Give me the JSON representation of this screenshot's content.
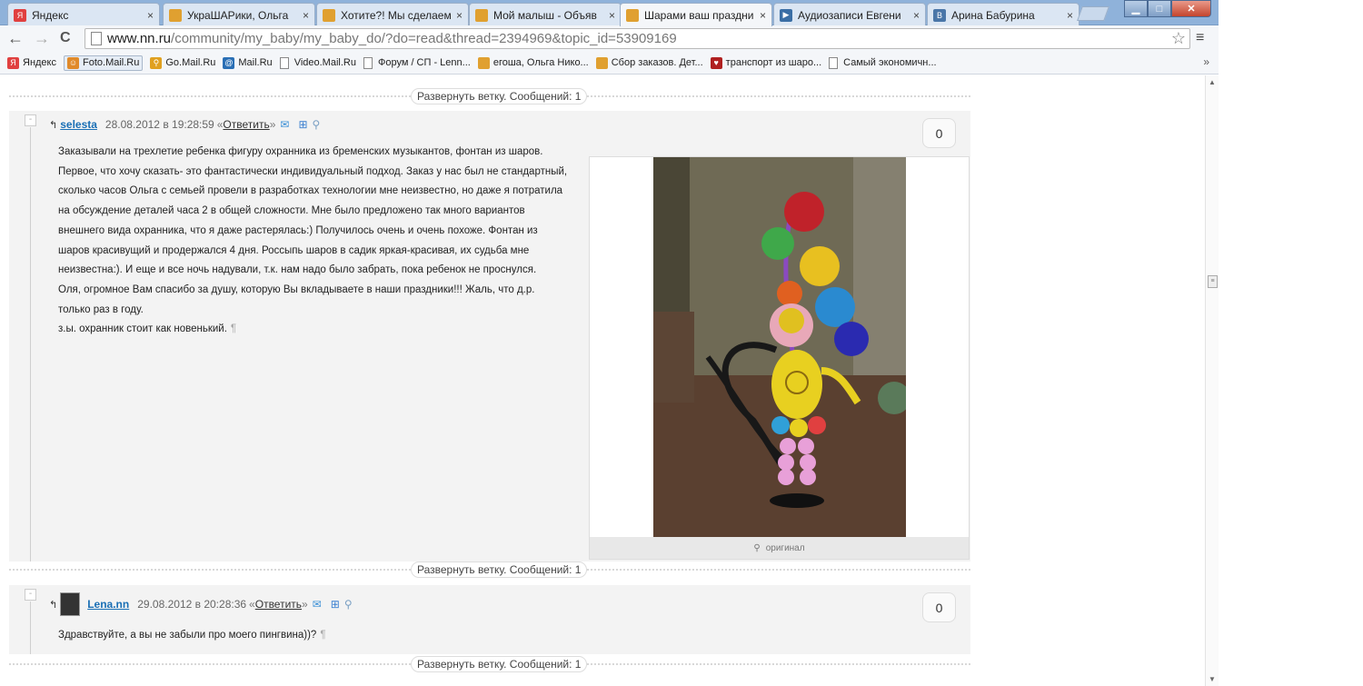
{
  "tabs": [
    {
      "title": "Яндекс",
      "icon": "yandex-icon",
      "color": "#e04040",
      "letter": "Я"
    },
    {
      "title": "УкраШАРики, Ольга",
      "icon": "page-icon",
      "color": "#e0a030",
      "letter": ""
    },
    {
      "title": "Хотите?! Мы сделаем",
      "icon": "page-icon",
      "color": "#e0a030",
      "letter": ""
    },
    {
      "title": "Мой малыш - Объяв",
      "icon": "page-icon",
      "color": "#e0a030",
      "letter": ""
    },
    {
      "title": "Шарами ваш праздни",
      "icon": "page-icon",
      "color": "#e0a030",
      "letter": "",
      "active": true
    },
    {
      "title": "Аудиозаписи Евгени",
      "icon": "play-icon",
      "color": "#3a6ea5",
      "letter": "▶"
    },
    {
      "title": "Арина Бабурина",
      "icon": "vk-icon",
      "color": "#4a76a8",
      "letter": "В"
    }
  ],
  "tab_close": "×",
  "window_controls": {
    "minimize": "▁",
    "maximize": "□",
    "close": "✕"
  },
  "nav": {
    "back": "←",
    "forward": "→",
    "reload": "C"
  },
  "address": {
    "host": "www.nn.ru",
    "path": "/community/my_baby/my_baby_do/?do=read&thread=2394969&topic_id=53909169"
  },
  "star": "☆",
  "menu": "≡",
  "bookmarks": [
    {
      "label": "Яндекс",
      "icon": "yandex-icon",
      "color": "#e04040",
      "letter": "Я"
    },
    {
      "label": "Foto.Mail.Ru",
      "icon": "people-icon",
      "color": "#e08a2a",
      "letter": "☺",
      "selected": true
    },
    {
      "label": "Go.Mail.Ru",
      "icon": "search-icon",
      "color": "#e0a020",
      "letter": "⚲"
    },
    {
      "label": "Mail.Ru",
      "icon": "at-icon",
      "color": "#2a6fb5",
      "letter": "@"
    },
    {
      "label": "Video.Mail.Ru",
      "icon": "page-icon",
      "color": "",
      "letter": ""
    },
    {
      "label": "Форум / СП - Lenn...",
      "icon": "page-icon",
      "color": "",
      "letter": ""
    },
    {
      "label": "егоша, Ольга Нико...",
      "icon": "page-icon",
      "color": "#e0a030",
      "letter": ""
    },
    {
      "label": "Сбор заказов. Дет...",
      "icon": "page-icon",
      "color": "#e0a030",
      "letter": ""
    },
    {
      "label": "транспорт из шаро...",
      "icon": "heart-icon",
      "color": "#b02020",
      "letter": "♥"
    },
    {
      "label": "Самый экономичн...",
      "icon": "page-icon",
      "color": "",
      "letter": ""
    }
  ],
  "bookmarks_more": "»",
  "expand_label": "Развернуть ветку. Сообщений: 1",
  "posts": [
    {
      "user": "selesta",
      "date": "28.08.2012 в 19:28:59",
      "reply_prefix": "«",
      "reply": "Ответить",
      "reply_suffix": "»",
      "score": "0",
      "lines": [
        "Заказывали на трехлетие ребенка фигуру охранника из бременских музыкантов, фонтан из шаров.",
        "Первое, что хочу сказать- это фантастически индивидуальный подход. Заказ у нас был не стандартный,",
        "сколько часов Ольга с семьей провели в разработках технологии мне неизвестно, но даже я потратила",
        "на обсуждение деталей часа 2 в общей сложности. Мне было предложено так много вариантов",
        "внешнего вида охранника, что я даже растерялась:) Получилось очень и очень похоже. Фонтан из",
        "шаров красивущий и продержался 4 дня. Россыпь шаров в садик яркая-красивая, их судьба мне",
        "неизвестна:). И еще и все ночь надували, т.к. нам надо было забрать, пока ребенок не проснулся.",
        "Оля, огромное Вам спасибо за душу, которую Вы вкладываете в наши праздники!!! Жаль, что д.р.",
        "только раз в году.",
        "з.ы. охранник стоит как новенький."
      ],
      "photo_caption": "оригинал"
    },
    {
      "user": "Lena.nn",
      "date": "29.08.2012 в 20:28:36",
      "reply_prefix": "«",
      "reply": "Ответить",
      "reply_suffix": "»",
      "score": "0",
      "lines": [
        "Здравствуйте, а вы не забыли про моего пингвина))?"
      ]
    }
  ],
  "collapse_symbol": "-",
  "reply_arrow": "↰",
  "pilcrow": "¶",
  "scroll": {
    "up": "▲",
    "down": "▼",
    "thumb": "≡"
  }
}
